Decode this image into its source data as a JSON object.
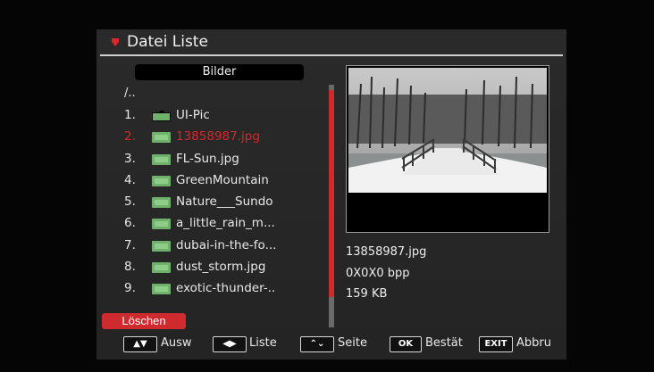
{
  "header": {
    "title": "Datei Liste"
  },
  "folder": {
    "name": "Bilder"
  },
  "list": {
    "parent": "/..",
    "items": [
      {
        "num": "1.",
        "name": "UI-Pic",
        "type": "folder"
      },
      {
        "num": "2.",
        "name": "13858987.jpg",
        "type": "image",
        "selected": true
      },
      {
        "num": "3.",
        "name": "FL-Sun.jpg",
        "type": "image"
      },
      {
        "num": "4.",
        "name": "GreenMountain",
        "type": "image"
      },
      {
        "num": "5.",
        "name": "Nature___Sundo",
        "type": "image"
      },
      {
        "num": "6.",
        "name": "a_little_rain_m...",
        "type": "image"
      },
      {
        "num": "7.",
        "name": "dubai-in-the-fo...",
        "type": "image"
      },
      {
        "num": "8.",
        "name": "dust_storm.jpg",
        "type": "image"
      },
      {
        "num": "9.",
        "name": "exotic-thunder-..",
        "type": "image"
      }
    ]
  },
  "preview": {
    "filename": "13858987.jpg",
    "bpp": "0X0X0 bpp",
    "size": "159 KB"
  },
  "actions": {
    "delete_label": "Löschen"
  },
  "footer": {
    "select_label": "Ausw",
    "list_label": "Liste",
    "page_label": "Seite",
    "ok_key": "OK",
    "confirm_label": "Bestät",
    "exit_key": "EXIT",
    "cancel_label": "Abbru"
  },
  "colors": {
    "accent": "#cf2a2e",
    "folder_icon": "#6fb06a",
    "panel": "#262626"
  }
}
